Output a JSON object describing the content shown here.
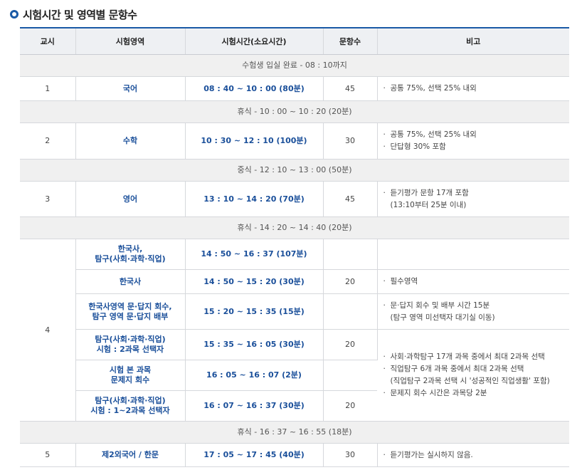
{
  "title": "시험시간 및 영역별 문항수",
  "headers": [
    "교시",
    "시험영역",
    "시험시간(소요시간)",
    "문항수",
    "비고"
  ],
  "rows": {
    "entry": "수험생 입실 완료 - 08 : 10까지",
    "p1": {
      "period": "1",
      "subject": "국어",
      "time": "08 : 40 ~ 10 : 00 (80분)",
      "count": "45",
      "note1": "공통 75%, 선택 25% 내외"
    },
    "break1": "휴식 - 10 : 00 ~ 10 : 20 (20분)",
    "p2": {
      "period": "2",
      "subject": "수학",
      "time": "10 : 30 ~ 12 : 10 (100분)",
      "count": "30",
      "note1": "공통 75%, 선택 25% 내외",
      "note2": "단답형 30% 포함"
    },
    "lunch": "중식 - 12 : 10 ~ 13 : 00 (50분)",
    "p3": {
      "period": "3",
      "subject": "영어",
      "time": "13 : 10 ~ 14 : 20 (70분)",
      "count": "45",
      "note1": "듣기평가 문항 17개 포함",
      "note2": "(13:10부터 25분 이내)"
    },
    "break2": "휴식 - 14 : 20 ~ 14 : 40 (20분)",
    "p4": {
      "period": "4",
      "r1": {
        "subject1": "한국사,",
        "subject2": "탐구(사회·과학·직업)",
        "time": "14 : 50 ~ 16 : 37 (107분)"
      },
      "r2": {
        "subject": "한국사",
        "time": "14 : 50 ~ 15 : 20 (30분)",
        "count": "20",
        "note1": "필수영역"
      },
      "r3": {
        "subject1": "한국사영역 문·답지 회수,",
        "subject2": "탐구 영역 문·답지 배부",
        "time": "15 : 20 ~ 15 : 35 (15분)",
        "note1": "문·답지 회수 및 배부 시간 15분",
        "note2": "(탐구 영역 미선택자 대기실 이동)"
      },
      "r4": {
        "subject1": "탐구(사회·과학·직업)",
        "subject2": "시험 : 2과목 선택자",
        "time": "15 : 35 ~ 16 : 05 (30분)",
        "count": "20"
      },
      "r5": {
        "subject1": "시험 본 과목",
        "subject2": "문제지 회수",
        "time": "16 : 05 ~ 16 : 07 (2분)"
      },
      "r6": {
        "subject1": "탐구(사회·과학·직업)",
        "subject2": "시험 : 1~2과목 선택자",
        "time": "16 : 07 ~ 16 : 37 (30분)",
        "count": "20"
      },
      "notes": {
        "n1": "사회·과학탐구 17개 과목 중에서 최대 2과목 선택",
        "n2": "직업탐구 6개 과목 중에서 최대 2과목 선택",
        "n2b": "(직업탐구 2과목 선택 시 '성공적인 직업생활' 포함)",
        "n3": "문제지 회수 시간은 과목당 2분"
      }
    },
    "break3": "휴식 - 16 : 37 ~ 16 : 55 (18분)",
    "p5": {
      "period": "5",
      "subject": "제2외국어 / 한문",
      "time": "17 : 05 ~ 17 : 45 (40분)",
      "count": "30",
      "note1": "듣기평가는 실시하지 않음."
    }
  }
}
